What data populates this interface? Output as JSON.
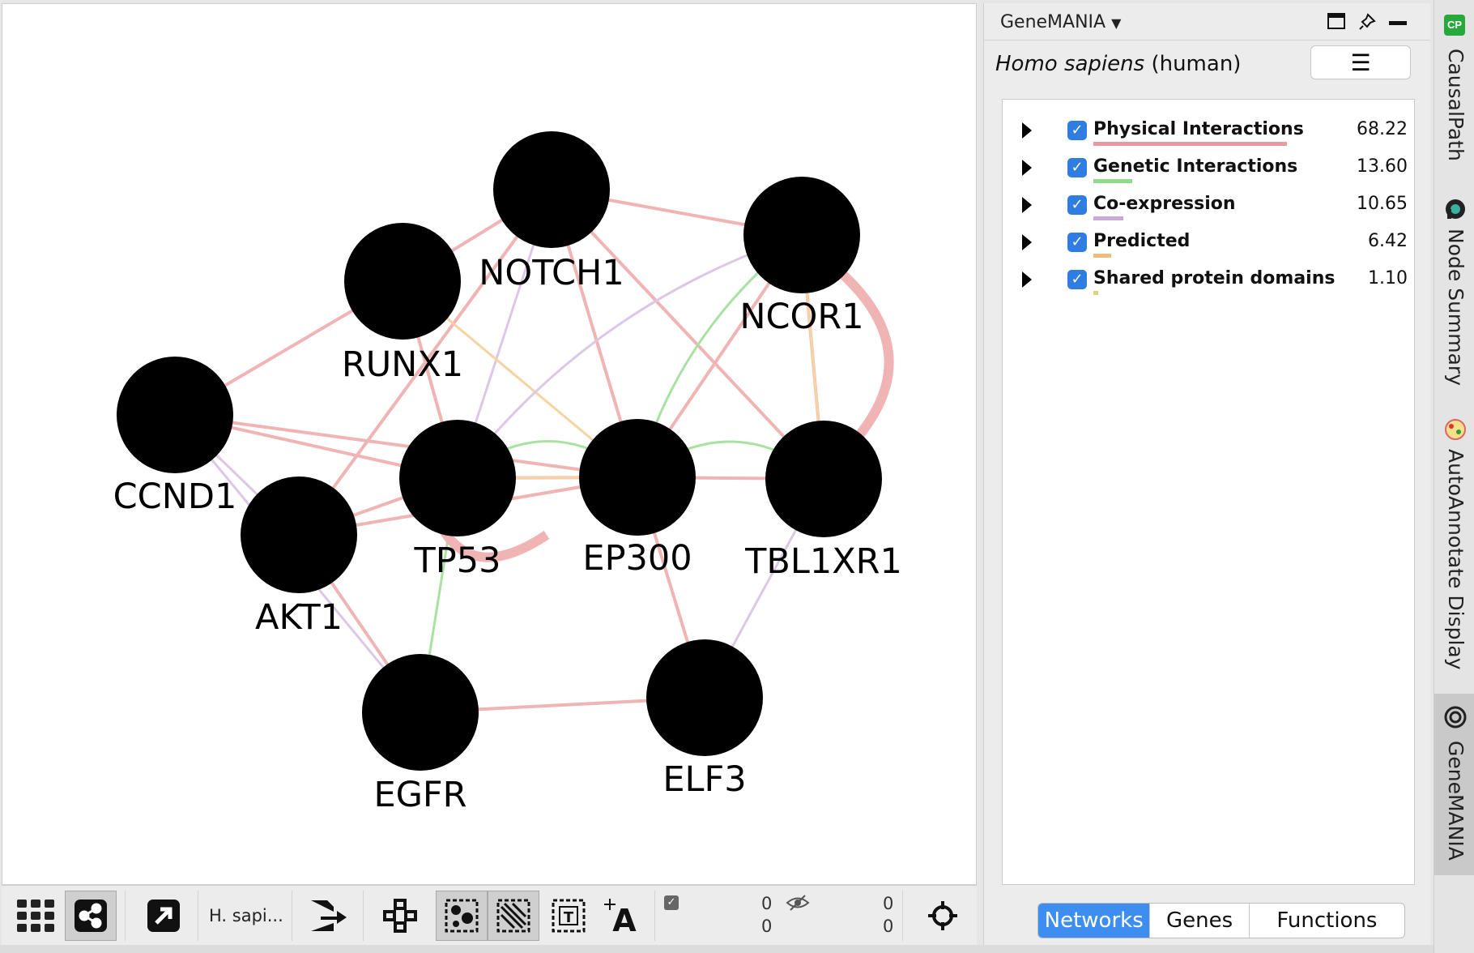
{
  "network": {
    "nodes": [
      {
        "id": "NOTCH1",
        "label": "NOTCH1"
      },
      {
        "id": "NCOR1",
        "label": "NCOR1"
      },
      {
        "id": "RUNX1",
        "label": "RUNX1"
      },
      {
        "id": "CCND1",
        "label": "CCND1"
      },
      {
        "id": "AKT1",
        "label": "AKT1"
      },
      {
        "id": "TP53",
        "label": "TP53"
      },
      {
        "id": "EP300",
        "label": "EP300"
      },
      {
        "id": "TBL1XR1",
        "label": "TBL1XR1"
      },
      {
        "id": "EGFR",
        "label": "EGFR"
      },
      {
        "id": "ELF3",
        "label": "ELF3"
      }
    ],
    "edges": [
      {
        "source": "NOTCH1",
        "target": "RUNX1",
        "type": "physical"
      },
      {
        "source": "NOTCH1",
        "target": "NCOR1",
        "type": "physical"
      },
      {
        "source": "NOTCH1",
        "target": "EP300",
        "type": "physical"
      },
      {
        "source": "NOTCH1",
        "target": "TBL1XR1",
        "type": "physical"
      },
      {
        "source": "NOTCH1",
        "target": "TP53",
        "type": "coexpression"
      },
      {
        "source": "NOTCH1",
        "target": "AKT1",
        "type": "physical"
      },
      {
        "source": "RUNX1",
        "target": "CCND1",
        "type": "physical"
      },
      {
        "source": "RUNX1",
        "target": "TP53",
        "type": "physical"
      },
      {
        "source": "RUNX1",
        "target": "EP300",
        "type": "predicted"
      },
      {
        "source": "NCOR1",
        "target": "TBL1XR1",
        "type": "physical"
      },
      {
        "source": "NCOR1",
        "target": "EP300",
        "type": "physical"
      },
      {
        "source": "NCOR1",
        "target": "TBL1XR1",
        "type": "predicted"
      },
      {
        "source": "NCOR1",
        "target": "EP300",
        "type": "genetic"
      },
      {
        "source": "NCOR1",
        "target": "TP53",
        "type": "coexpression"
      },
      {
        "source": "CCND1",
        "target": "TP53",
        "type": "physical"
      },
      {
        "source": "CCND1",
        "target": "EP300",
        "type": "physical"
      },
      {
        "source": "CCND1",
        "target": "AKT1",
        "type": "coexpression"
      },
      {
        "source": "CCND1",
        "target": "EGFR",
        "type": "coexpression"
      },
      {
        "source": "AKT1",
        "target": "TP53",
        "type": "physical"
      },
      {
        "source": "AKT1",
        "target": "EP300",
        "type": "physical"
      },
      {
        "source": "AKT1",
        "target": "EGFR",
        "type": "physical"
      },
      {
        "source": "TP53",
        "target": "EP300",
        "type": "physical"
      },
      {
        "source": "TP53",
        "target": "EP300",
        "type": "genetic"
      },
      {
        "source": "TP53",
        "target": "EP300",
        "type": "predicted"
      },
      {
        "source": "TP53",
        "target": "EGFR",
        "type": "genetic"
      },
      {
        "source": "EP300",
        "target": "TBL1XR1",
        "type": "physical"
      },
      {
        "source": "EP300",
        "target": "TBL1XR1",
        "type": "genetic"
      },
      {
        "source": "EP300",
        "target": "ELF3",
        "type": "physical"
      },
      {
        "source": "TBL1XR1",
        "target": "ELF3",
        "type": "coexpression"
      },
      {
        "source": "EGFR",
        "target": "ELF3",
        "type": "physical"
      }
    ],
    "self_loops": [
      {
        "node": "TP53",
        "type": "physical"
      },
      {
        "node": "NCOR1",
        "type": "physical"
      }
    ]
  },
  "toolbar": {
    "network_name": "H. sapi...",
    "counters": {
      "top_left": "0",
      "bottom_left": "0",
      "top_right": "0",
      "bottom_right": "0"
    }
  },
  "panel": {
    "title": "GeneMANIA",
    "organism_italic": "Homo sapiens",
    "organism_common": " (human)",
    "networks": [
      {
        "label": "Physical Interactions",
        "value": "68.22",
        "color": "#e89aa0",
        "bar_fraction": 0.6822
      },
      {
        "label": "Genetic Interactions",
        "value": "13.60",
        "color": "#8fdc88",
        "bar_fraction": 0.136
      },
      {
        "label": "Co-expression",
        "value": "10.65",
        "color": "#c9a9d8",
        "bar_fraction": 0.1065
      },
      {
        "label": "Predicted",
        "value": "6.42",
        "color": "#f3bb7a",
        "bar_fraction": 0.0642
      },
      {
        "label": "Shared protein domains",
        "value": "1.10",
        "color": "#d7d77a",
        "bar_fraction": 0.011
      }
    ],
    "tabs": [
      "Networks",
      "Genes",
      "Functions"
    ]
  },
  "sidebar": {
    "tabs": [
      {
        "label": "CausalPath",
        "icon": "causalpath-icon"
      },
      {
        "label": "Node Summary",
        "icon": "node-summary-icon"
      },
      {
        "label": "AutoAnnotate Display",
        "icon": "autoannotate-icon"
      },
      {
        "label": "GeneMANIA",
        "icon": "genemania-icon"
      }
    ]
  },
  "colors": {
    "physical": "#f0b4b4",
    "genetic": "#a8e2a0",
    "coexpression": "#dcc7e6",
    "predicted": "#f6d3a3",
    "checkbox": "#2f7de0",
    "active_tab": "#3d8ef0"
  }
}
